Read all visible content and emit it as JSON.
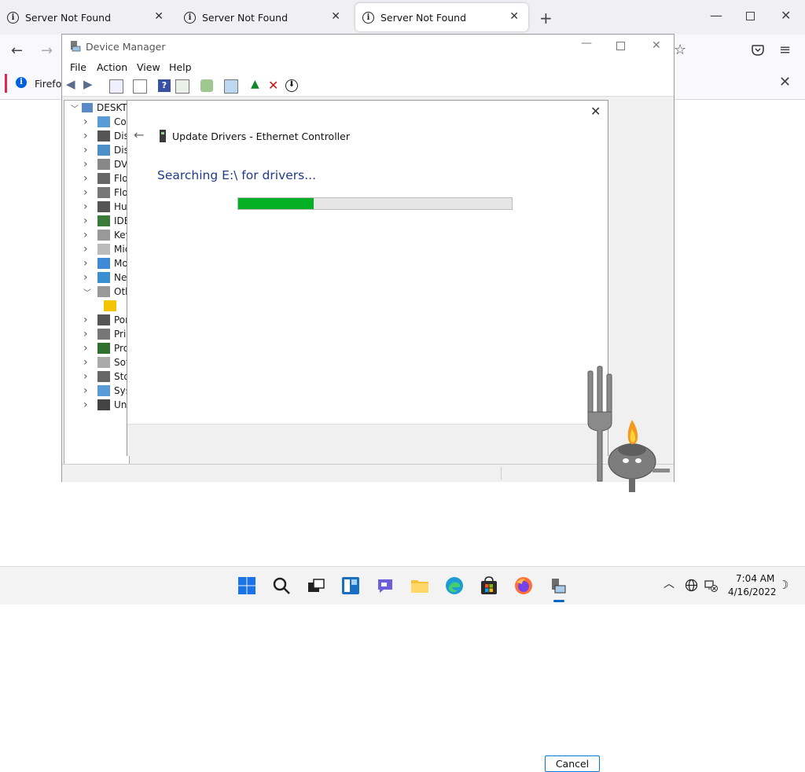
{
  "browser": {
    "tabs": [
      {
        "title": "Server Not Found",
        "active": false
      },
      {
        "title": "Server Not Found",
        "active": false
      },
      {
        "title": "Server Not Found",
        "active": true
      }
    ],
    "new_tab_icon": "plus-icon",
    "infobar_text": "Firefox"
  },
  "device_manager": {
    "title": "Device Manager",
    "menu": [
      "File",
      "Action",
      "View",
      "Help"
    ],
    "root": "DESKTOP",
    "tree": [
      {
        "label": "Cor",
        "expanded": false,
        "icon": "computer-icon"
      },
      {
        "label": "Disk",
        "expanded": false,
        "icon": "disk-icon"
      },
      {
        "label": "Disp",
        "expanded": false,
        "icon": "display-icon"
      },
      {
        "label": "DVD",
        "expanded": false,
        "icon": "dvd-icon"
      },
      {
        "label": "Flop",
        "expanded": false,
        "icon": "floppy-icon"
      },
      {
        "label": "Flop",
        "expanded": false,
        "icon": "floppy-controller-icon"
      },
      {
        "label": "Hur",
        "expanded": false,
        "icon": "hid-icon"
      },
      {
        "label": "IDE",
        "expanded": false,
        "icon": "ide-icon"
      },
      {
        "label": "Key",
        "expanded": false,
        "icon": "keyboard-icon"
      },
      {
        "label": "Mic",
        "expanded": false,
        "icon": "mouse-icon"
      },
      {
        "label": "Mo",
        "expanded": false,
        "icon": "monitor-icon"
      },
      {
        "label": "Net",
        "expanded": false,
        "icon": "network-icon"
      },
      {
        "label": "Oth",
        "expanded": true,
        "icon": "unknown-device-icon"
      },
      {
        "label": "",
        "expanded": null,
        "icon": "warning-device-icon"
      },
      {
        "label": "Por",
        "expanded": false,
        "icon": "port-icon"
      },
      {
        "label": "Prir",
        "expanded": false,
        "icon": "printer-icon"
      },
      {
        "label": "Pro",
        "expanded": false,
        "icon": "processor-icon"
      },
      {
        "label": "Soft",
        "expanded": false,
        "icon": "software-icon"
      },
      {
        "label": "Stor",
        "expanded": false,
        "icon": "storage-icon"
      },
      {
        "label": "Syst",
        "expanded": false,
        "icon": "system-icon"
      },
      {
        "label": "Uni",
        "expanded": false,
        "icon": "usb-icon"
      }
    ]
  },
  "wizard": {
    "title": "Update Drivers - Ethernet Controller",
    "status": "Searching E:\\ for drivers...",
    "progress": 0.275,
    "cancel_label": "Cancel",
    "progress_color": "#06b025"
  },
  "taskbar": {
    "time": "7:04 AM",
    "date": "4/16/2022",
    "apps": [
      "start-icon",
      "search-icon",
      "task-view-icon",
      "widgets-icon",
      "chat-icon",
      "file-explorer-icon",
      "edge-icon",
      "store-icon",
      "firefox-icon",
      "device-manager-icon"
    ]
  }
}
